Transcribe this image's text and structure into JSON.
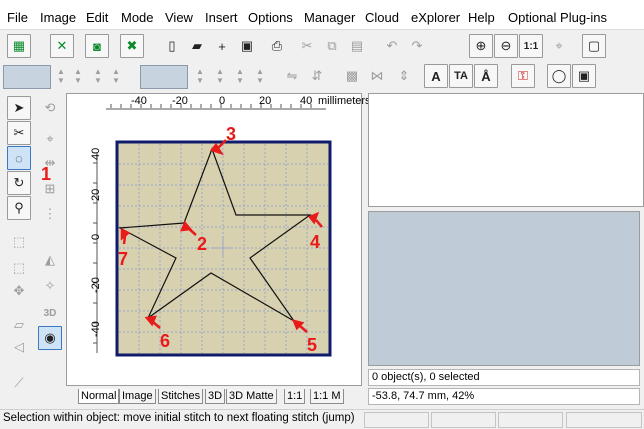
{
  "menu": [
    "File",
    "Image",
    "Edit",
    "Mode",
    "View",
    "Insert",
    "Options",
    "Manager",
    "Cloud",
    "eXplorer",
    "Help",
    "Optional Plug-ins"
  ],
  "ruler": {
    "unit": "millimeters",
    "x_ticks": [
      "-40",
      "-20",
      "0",
      "20",
      "40"
    ],
    "y_ticks": [
      "40",
      "20",
      "0",
      "-20",
      "-40"
    ]
  },
  "annotations": [
    "1",
    "2",
    "3",
    "4",
    "5",
    "6",
    "7"
  ],
  "tabs": [
    "Normal",
    "Image",
    "Stitches",
    "3D",
    "3D Matte",
    "1:1",
    "1:1 M"
  ],
  "panel": {
    "objects_line": "0 object(s), 0 selected",
    "coords_line": "-53.8, 74.7 mm, 42%"
  },
  "status": {
    "text": "Selection within object: move initial stitch to next floating stitch (jump)"
  },
  "colors": {
    "hoop_fill": "#d8d1b0",
    "hoop_border": "#0f1b6b",
    "grid": "#9aa6c8",
    "annotation": "#e81a1a",
    "preview": "#bfcbd7"
  },
  "icons": {
    "toolbar1": [
      "grid-view-icon",
      "magic-wand-icon",
      "camera-icon",
      "wand-cross-icon",
      "new-file-icon",
      "open-folder-icon",
      "add-icon",
      "save-icon",
      "print-icon",
      "cut-icon",
      "copy-icon",
      "paste-icon",
      "undo-icon",
      "redo-icon",
      "zoom-in-icon",
      "zoom-out-icon",
      "zoom-1to1-icon",
      "zoom-fit-icon",
      "hoop-icon"
    ],
    "left_tools": [
      "select-arrow-icon",
      "edit-nodes-icon",
      "lasso-select-icon",
      "rotate-icon",
      "zoom-icon"
    ]
  }
}
